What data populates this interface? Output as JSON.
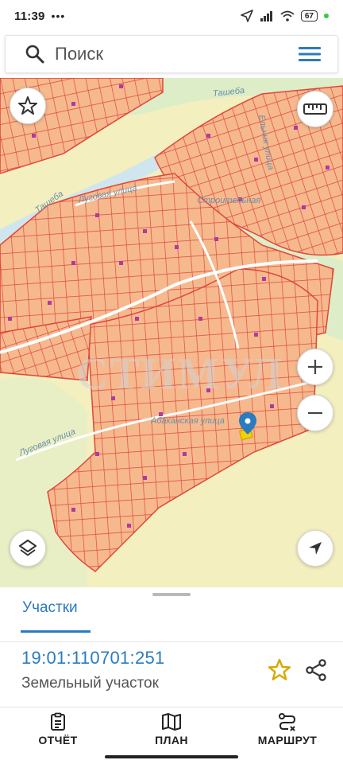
{
  "status_bar": {
    "time": "11:39",
    "dots": "•••",
    "battery": "67"
  },
  "search": {
    "placeholder": "Поиск"
  },
  "map": {
    "labels": {
      "river_top": "Ташеба",
      "river_left": "Ташеба",
      "street_lugovaya_top": "Луговая улица",
      "street_lugovaya_bottom": "Луговая улица",
      "street_stroitelnaya": "Строительная",
      "street_mid": "Абаканская улица",
      "street_vertical": "Ельник улица"
    },
    "watermark": "СТИМУЛ",
    "colors": {
      "parcel_fill": "#f6b98e",
      "parcel_stroke": "#e0463a",
      "background": "#f4efbf",
      "river": "#cfe6ee",
      "green": "#dcedc8",
      "marker": "#b03aa0",
      "selected": "#f4d200"
    }
  },
  "sheet": {
    "tab_label": "Участки",
    "parcel": {
      "cadastral_number": "19:01:110701:251",
      "type": "Земельный участок"
    }
  },
  "bottom_nav": {
    "report": "ОТЧЁТ",
    "plan": "ПЛАН",
    "route": "МАРШРУТ"
  },
  "accent_color": "#2b7bbf"
}
